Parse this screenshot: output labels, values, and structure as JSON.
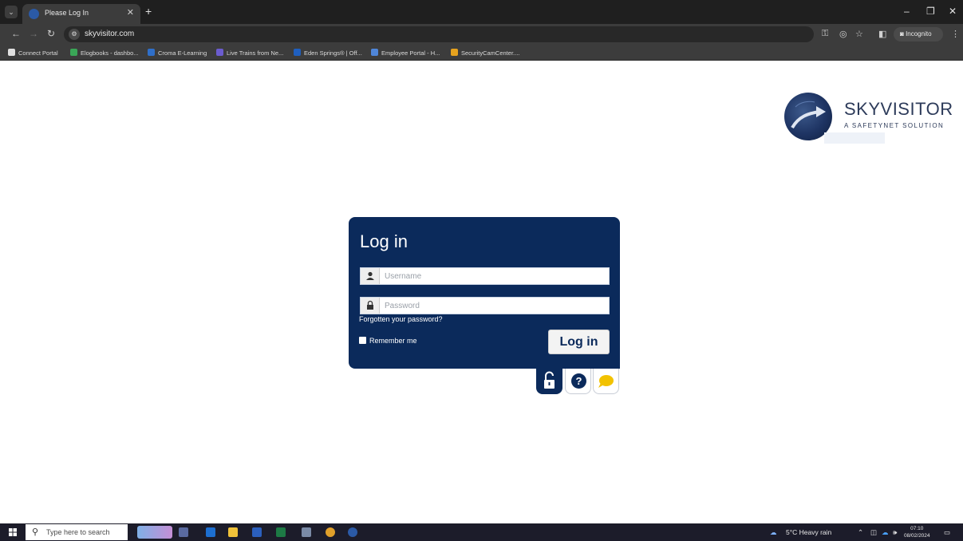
{
  "browser": {
    "tab_title": "Please Log In",
    "url": "skyvisitor.com",
    "incognito_label": "Incognito",
    "bookmarks": [
      {
        "label": "Connect Portal",
        "color": "#e0e0e0"
      },
      {
        "label": "Elogbooks - dashbo...",
        "color": "#3aa657"
      },
      {
        "label": "Croma E-Learning",
        "color": "#2f6fc9"
      },
      {
        "label": "Live Trains from Ne...",
        "color": "#6b5ccf"
      },
      {
        "label": "Eden Springs® | Off...",
        "color": "#1f5fbf"
      },
      {
        "label": "Employee Portal - H...",
        "color": "#4f86d9"
      },
      {
        "label": "SecurityCamCenter....",
        "color": "#e6a21e"
      }
    ]
  },
  "logo": {
    "title": "SKYVISITOR",
    "subtitle": "A SAFETYNET SOLUTION"
  },
  "login": {
    "title": "Log in",
    "username_placeholder": "Username",
    "password_placeholder": "Password",
    "forgot_label": "Forgotten your password?",
    "remember_label": "Remember me",
    "submit_label": "Log in"
  },
  "taskbar": {
    "search_placeholder": "Type here to search",
    "weather": "5°C  Heavy rain",
    "time": "07:10",
    "date": "08/02/2024"
  },
  "colors": {
    "card": "#0b2a5b",
    "brand_text": "#2d3b5a",
    "chrome_dark": "#1f1f1f",
    "chrome_toolbar": "#3c3c3c",
    "taskbar": "#1c1c2a"
  }
}
